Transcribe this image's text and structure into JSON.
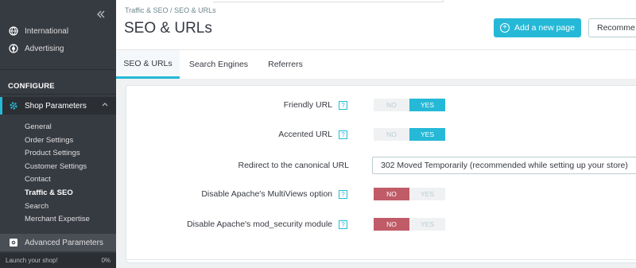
{
  "sidebar": {
    "collapse_icon": "double-chevron-left-icon",
    "items_top": [
      {
        "label": "International",
        "icon": "globe-icon"
      },
      {
        "label": "Advertising",
        "icon": "megaphone-icon"
      }
    ],
    "section_heading": "CONFIGURE",
    "active_item": {
      "label": "Shop Parameters",
      "icon": "gear-icon",
      "expand_icon": "chevron-up-icon"
    },
    "subitems": [
      {
        "label": "General"
      },
      {
        "label": "Order Settings"
      },
      {
        "label": "Product Settings"
      },
      {
        "label": "Customer Settings"
      },
      {
        "label": "Contact"
      },
      {
        "label": "Traffic & SEO"
      },
      {
        "label": "Search"
      },
      {
        "label": "Merchant Expertise"
      }
    ],
    "current_subitem": "Traffic & SEO",
    "advanced_item": {
      "label": "Advanced Parameters",
      "icon": "settings-box-icon"
    },
    "launch": {
      "label": "Launch your shop!",
      "progress": "0%"
    }
  },
  "header": {
    "breadcrumb": [
      "Traffic & SEO",
      "SEO & URLs"
    ],
    "breadcrumb_separator": "/",
    "title": "SEO & URLs",
    "add_button_label": "Add a new page",
    "recommended_button_label": "Recomme"
  },
  "tabs": [
    {
      "label": "SEO & URLs",
      "active": true
    },
    {
      "label": "Search Engines",
      "active": false
    },
    {
      "label": "Referrers",
      "active": false
    }
  ],
  "form": {
    "help_glyph": "?",
    "rows": [
      {
        "label": "Friendly URL",
        "no": "NO",
        "yes": "YES",
        "value": "YES"
      },
      {
        "label": "Accented URL",
        "no": "NO",
        "yes": "YES",
        "value": "YES"
      },
      {
        "label": "Redirect to the canonical URL",
        "select_value": "302 Moved Temporarily (recommended while setting up your store)"
      },
      {
        "label": "Disable Apache's MultiViews option",
        "no": "NO",
        "yes": "YES",
        "value": "NO"
      },
      {
        "label": "Disable Apache's mod_security module",
        "no": "NO",
        "yes": "YES",
        "value": "NO"
      }
    ]
  },
  "colors": {
    "accent": "#25b9d7",
    "danger": "#c05c67",
    "sidebar_bg": "#363a41"
  }
}
